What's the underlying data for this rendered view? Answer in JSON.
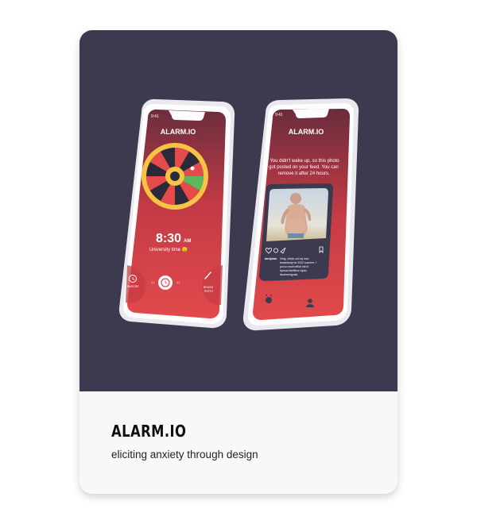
{
  "card": {
    "title": "ALARM.IO",
    "subtitle": "eliciting anxiety through design"
  },
  "phone_left": {
    "status_time": "9:41",
    "app_name": "ALARM.IO",
    "alarm_time": "8:30",
    "alarm_ampm": "AM",
    "alarm_label": "University time 😴",
    "left_action": "SNOOZE",
    "right_action_line1": "BRUSH",
    "right_action_line2": "TEETH",
    "icons": [
      "roulette-wheel-icon",
      "alarm-clock-icon",
      "toothbrush-icon"
    ]
  },
  "phone_right": {
    "status_time": "9:41",
    "app_name": "ALARM.IO",
    "message_line1": "You didn't wake up, so this photo",
    "message_line2": "got posted on your feed. You can",
    "message_line3": "remove it after 24 hours.",
    "post_username": "alexjolan",
    "post_caption_line1": "Omg, check out my new",
    "post_caption_line2": "beachbody for 2022 summer. I",
    "post_caption_line3": "put so much effort into it.",
    "post_caption_line4": "#proud #selflove #yolo",
    "post_caption_line5": "#summergoals",
    "icons": [
      "heart-icon",
      "comment-icon",
      "send-icon",
      "bookmark-icon",
      "alarm-tab-icon",
      "profile-tab-icon"
    ]
  },
  "colors": {
    "card_background": "#3c3a4f",
    "app_red": "#d9424a",
    "wheel_yellow": "#f6c344"
  }
}
